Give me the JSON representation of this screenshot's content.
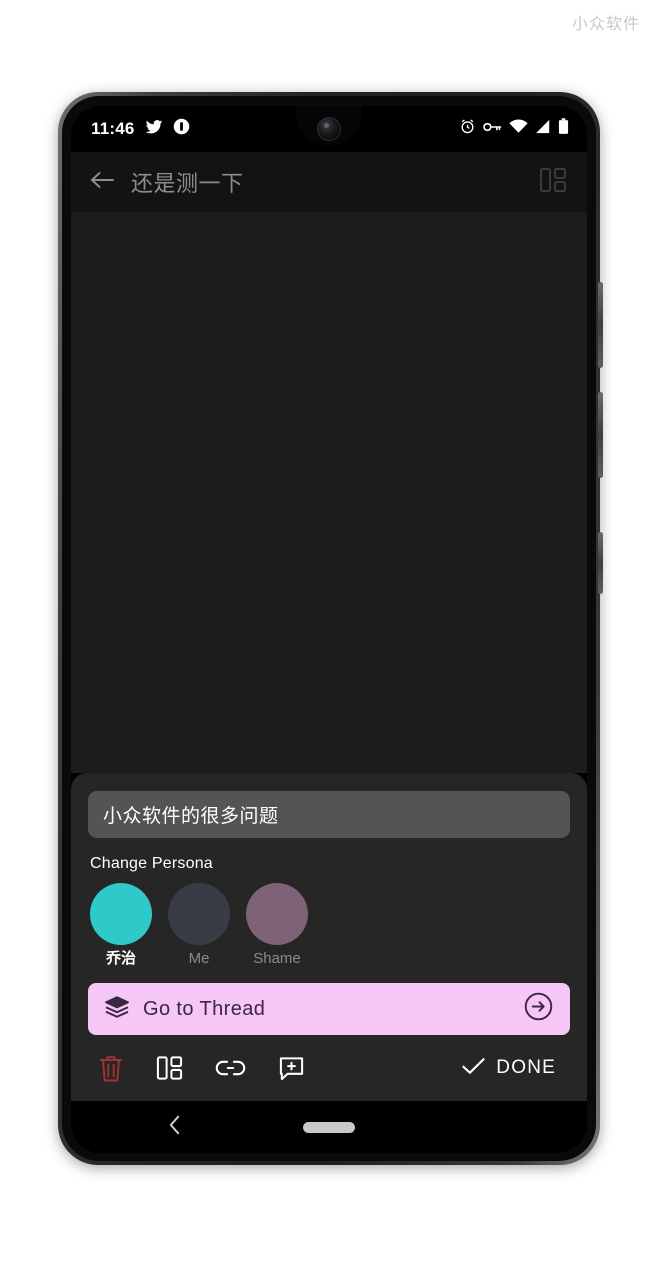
{
  "watermark": "小众软件",
  "status_bar": {
    "time": "11:46",
    "left_icons": [
      "twitter-icon",
      "notification-icon"
    ],
    "right_icons": [
      "alarm-icon",
      "vpn-key-icon",
      "wifi-icon",
      "cell-signal-icon",
      "battery-icon"
    ]
  },
  "app_bar": {
    "back_icon": "back-arrow-icon",
    "title": "还是测一下",
    "action_icon": "dashboard-icon"
  },
  "sheet": {
    "input": {
      "value": "小众软件的很多问题",
      "placeholder": "小众软件的很多问题"
    },
    "persona_section": {
      "label": "Change Persona",
      "items": [
        {
          "name": "乔治",
          "color": "#2FC9C9",
          "selected": true
        },
        {
          "name": "Me",
          "color": "#383C44",
          "selected": false
        },
        {
          "name": "Shame",
          "color": "#7E6277",
          "selected": false
        }
      ]
    },
    "thread_button": {
      "label": "Go to Thread",
      "leading_icon": "layers-icon",
      "trailing_icon": "arrow-circle-right-icon",
      "background": "#F5C6F6",
      "text_color": "#3A2742"
    },
    "toolbar": {
      "items": [
        {
          "icon": "trash-icon",
          "color": "#A33232"
        },
        {
          "icon": "dashboard-icon",
          "color": "#FFFFFF"
        },
        {
          "icon": "link-icon",
          "color": "#FFFFFF"
        },
        {
          "icon": "add-comment-icon",
          "color": "#FFFFFF"
        }
      ],
      "done": {
        "icon": "check-icon",
        "label": "DONE"
      }
    }
  },
  "nav_bar": {
    "back_icon": "nav-back-chevron-icon",
    "home_indicator": "home-pill-icon"
  }
}
